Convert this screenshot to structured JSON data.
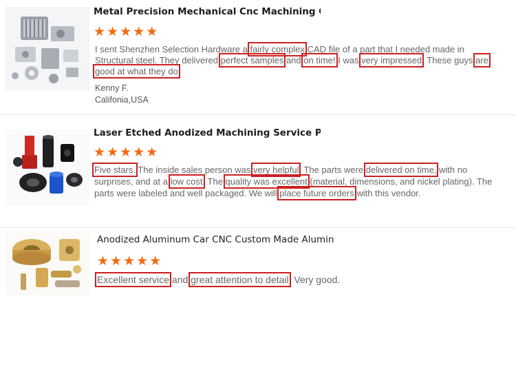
{
  "reviews": [
    {
      "title": "Metal Precision Mechanical Cnc Machining Cu...",
      "rating": 5,
      "parts": [
        {
          "t": "I sent Shenzhen Selection Hardware a ",
          "hl": false
        },
        {
          "t": "fairly complex",
          "hl": true
        },
        {
          "t": " CAD file of a part that I needed made in Structural steel. They delivered ",
          "hl": false
        },
        {
          "t": "perfect samples",
          "hl": true
        },
        {
          "t": " and ",
          "hl": false
        },
        {
          "t": "on time!",
          "hl": true
        },
        {
          "t": " I was ",
          "hl": false
        },
        {
          "t": "very impressed",
          "hl": true
        },
        {
          "t": ". These guys ",
          "hl": false
        },
        {
          "t": "are good at what they do",
          "hl": true
        },
        {
          "t": ".",
          "hl": false
        }
      ],
      "author": "Kenny F.",
      "location": "Califonia,USA"
    },
    {
      "title": "Laser Etched Anodized Machining Service Prec...",
      "rating": 5,
      "parts": [
        {
          "t": "Five stars.",
          "hl": true
        },
        {
          "t": " The inside sales person was ",
          "hl": false
        },
        {
          "t": "very helpful",
          "hl": true
        },
        {
          "t": ". The parts were ",
          "hl": false
        },
        {
          "t": "delivered on time,",
          "hl": true
        },
        {
          "t": " with no surprises, and at a ",
          "hl": false
        },
        {
          "t": "low cost",
          "hl": true
        },
        {
          "t": ". The ",
          "hl": false
        },
        {
          "t": "quality was excellent",
          "hl": true
        },
        {
          "t": " (material, dimensions, and nickel plating). The parts were labeled and well packaged. We will ",
          "hl": false
        },
        {
          "t": "place future orders",
          "hl": true
        },
        {
          "t": " with this vendor.",
          "hl": false
        }
      ]
    },
    {
      "title": "Anodized Aluminum Car CNC Custom Made Aluminu...",
      "rating": 5,
      "parts": [
        {
          "t": "Excellent service",
          "hl": true
        },
        {
          "t": " and ",
          "hl": false
        },
        {
          "t": "great attention to detail",
          "hl": true
        },
        {
          "t": "  Very good.",
          "hl": false
        }
      ]
    }
  ],
  "colors": {
    "star": "#f26b12",
    "highlight_box": "#cc1f1f"
  }
}
